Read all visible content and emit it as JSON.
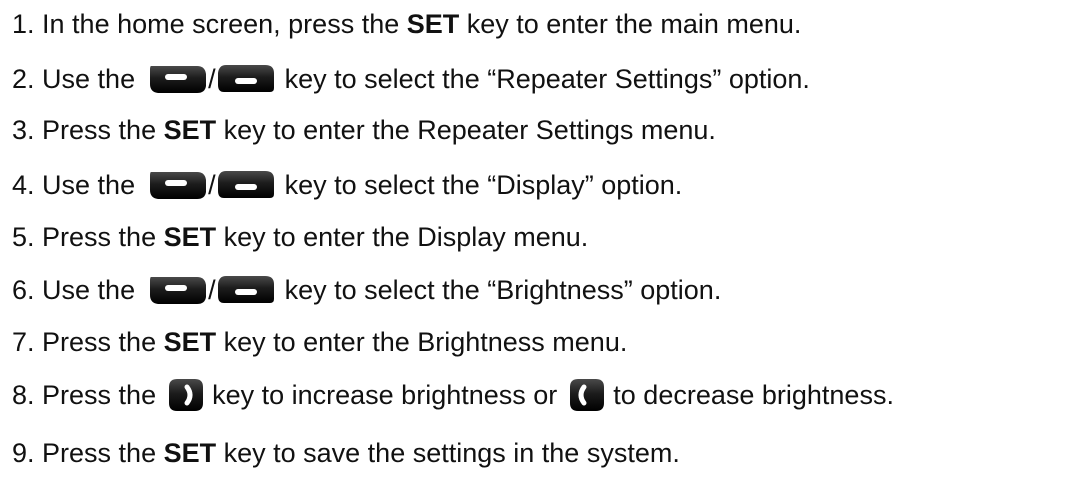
{
  "steps": [
    {
      "num": "1.",
      "pre": " In the home screen, press the ",
      "bold": "SET",
      "post": " key to enter the main menu."
    },
    {
      "num": "2.",
      "pre": " Use the",
      "post": "key to select the “Repeater Settings” option."
    },
    {
      "num": "3.",
      "pre": " Press the ",
      "bold": "SET",
      "post": " key to enter the Repeater Settings menu."
    },
    {
      "num": "4.",
      "pre": " Use the",
      "post": "key to select the “Display” option."
    },
    {
      "num": "5.",
      "pre": " Press the ",
      "bold": "SET",
      "post": " key to enter the Display menu."
    },
    {
      "num": "6.",
      "pre": " Use the",
      "post": "key to select the “Brightness” option."
    },
    {
      "num": "7.",
      "pre": " Press the ",
      "bold": "SET",
      "post": " key to enter the Brightness menu."
    },
    {
      "num": "8.",
      "pre": " Press the",
      "mid": "key to increase brightness or",
      "post": "to decrease brightness."
    },
    {
      "num": "9.",
      "pre": " Press the ",
      "bold": "SET",
      "post": " key to save the settings in the system."
    }
  ],
  "separator": "/",
  "icons": {
    "up_key": "up-key-icon",
    "down_key": "down-key-icon",
    "right_key": "right-key-icon",
    "left_key": "left-key-icon"
  },
  "colors": {
    "key_body": "#1a1a1a",
    "key_mark": "#ffffff",
    "text": "#111111"
  }
}
